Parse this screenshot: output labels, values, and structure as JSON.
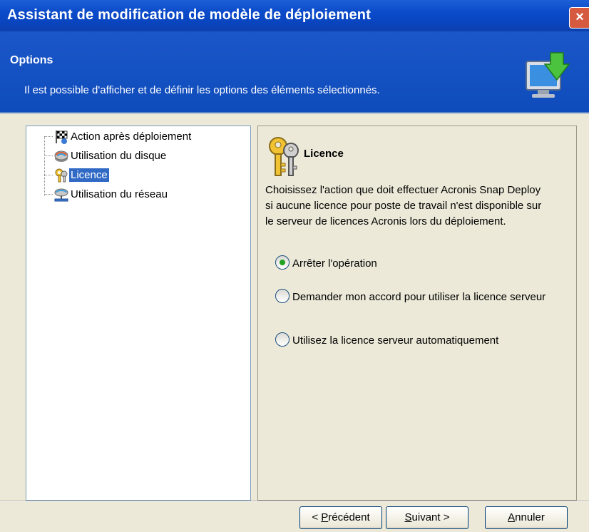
{
  "window": {
    "title": "Assistant de modification de modèle de déploiement",
    "close_label": "×"
  },
  "header": {
    "title": "Options",
    "description": "Il est possible d'afficher et de définir les options des éléments sélectionnés."
  },
  "tree": {
    "items": [
      {
        "label": "Action après déploiement",
        "icon": "checkered-flag-icon"
      },
      {
        "label": "Utilisation du disque",
        "icon": "disk-icon"
      },
      {
        "label": "Licence",
        "icon": "keys-icon",
        "selected": true
      },
      {
        "label": "Utilisation du réseau",
        "icon": "network-icon"
      }
    ]
  },
  "content": {
    "title": "Licence",
    "description": "Choisissez l'action que doit effectuer Acronis Snap Deploy si aucune licence pour poste de travail n'est disponible sur le serveur de licences Acronis lors du déploiement.",
    "options": [
      {
        "label": "Arrêter l'opération",
        "checked": true
      },
      {
        "label": "Demander mon accord pour utiliser la licence serveur",
        "checked": false
      },
      {
        "label": "Utilisez la licence serveur automatiquement",
        "checked": false
      }
    ]
  },
  "buttons": {
    "back_prefix": "< ",
    "back_mnemonic": "P",
    "back_rest": "récédent",
    "next_mnemonic": "S",
    "next_rest": "uivant >",
    "cancel_mnemonic": "A",
    "cancel_rest": "nnuler"
  },
  "colors": {
    "title_bar": "#0b4ac9",
    "selection": "#316AC5",
    "radio_selected": "#21a121",
    "background": "#ECE9D8"
  }
}
